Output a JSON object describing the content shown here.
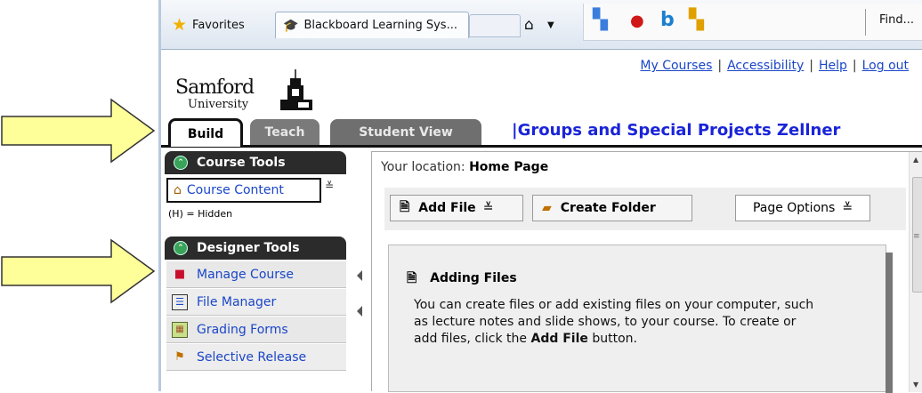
{
  "browser": {
    "favorites_label": "Favorites",
    "tab_title": "Blackboard Learning Sys...",
    "find_label": "Find..."
  },
  "page": {
    "logo": {
      "wordmark": "Samford",
      "sub": "University"
    },
    "top_links": [
      "My Courses",
      "Accessibility",
      "Help",
      "Log out"
    ],
    "tabs": [
      {
        "label": "Build",
        "active": true
      },
      {
        "label": "Teach",
        "active": false
      },
      {
        "label": "Student View",
        "active": false
      }
    ],
    "course_title": "|Groups and Special Projects Zellner"
  },
  "left_nav": {
    "course_tools": {
      "header": "Course Tools",
      "items": [
        {
          "label": "Course Content",
          "icon": "home-icon"
        }
      ]
    },
    "hidden_note": "(H) = Hidden",
    "designer_tools": {
      "header": "Designer Tools",
      "items": [
        {
          "label": "Manage Course",
          "icon": "toolbox-icon"
        },
        {
          "label": "File Manager",
          "icon": "file-manager-icon"
        },
        {
          "label": "Grading Forms",
          "icon": "grading-icon"
        },
        {
          "label": "Selective Release",
          "icon": "selective-release-icon"
        }
      ]
    }
  },
  "main": {
    "location_label": "Your location:",
    "location_value": "Home Page",
    "toolbar": {
      "add_file": "Add File",
      "create_folder": "Create Folder",
      "page_options": "Page Options"
    },
    "info": {
      "title": "Adding Files",
      "body": "You can create files or add existing files on your computer, such as lecture notes and slide shows, to your course. To create or add files, click the",
      "body_bold": "Add File",
      "body_end": "button."
    }
  },
  "colors": {
    "link": "#1a46c8",
    "course_title": "#1a24d8",
    "nav_header": "#2b2b2b",
    "arrow_fill": "#ffff99"
  }
}
